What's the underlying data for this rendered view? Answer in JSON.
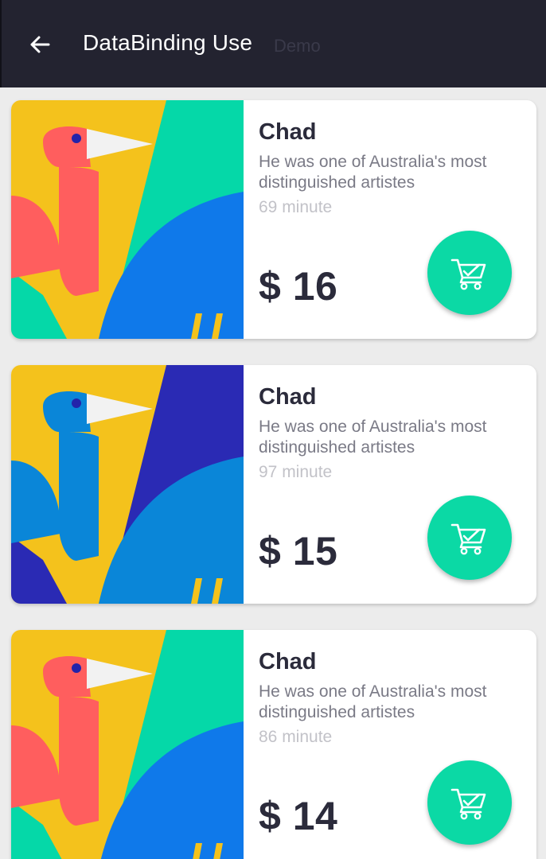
{
  "toolbar": {
    "title": "DataBinding Use",
    "subtitle": "Demo",
    "back_icon": "arrow-left-icon"
  },
  "items": [
    {
      "name": "Chad",
      "description": "He was one of Australia's most distinguished artistes",
      "duration": "69 minute",
      "price": "$ 16",
      "colors": {
        "background": "#f4c21c",
        "accent": "#05d8a8",
        "bird": "#ff5e5e",
        "wing": "#0f79ea",
        "eye": "#2323aa"
      },
      "cart_icon": "shopping-cart-check-icon"
    },
    {
      "name": "Chad",
      "description": "He was one of Australia's most distinguished artistes",
      "duration": "97 minute",
      "price": "$ 15",
      "colors": {
        "background": "#f4c21c",
        "accent": "#2a2ab4",
        "bird": "#0a86d8",
        "wing": "#0a86d8",
        "eye": "#2323aa"
      },
      "cart_icon": "shopping-cart-check-icon"
    },
    {
      "name": "Chad",
      "description": "He was one of Australia's most distinguished artistes",
      "duration": "86 minute",
      "price": "$ 14",
      "colors": {
        "background": "#f4c21c",
        "accent": "#05d8a8",
        "bird": "#ff5e5e",
        "wing": "#0f79ea",
        "eye": "#2323aa"
      },
      "cart_icon": "shopping-cart-check-icon"
    }
  ]
}
